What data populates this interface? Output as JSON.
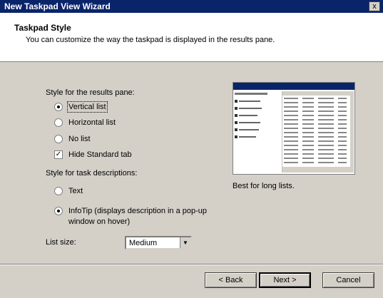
{
  "window": {
    "title": "New Taskpad View Wizard",
    "close_glyph": "x"
  },
  "header": {
    "title": "Taskpad Style",
    "subtitle": "You can customize the way the taskpad is displayed in the results pane."
  },
  "results_pane": {
    "label": "Style for the results pane:",
    "options": [
      {
        "label": "Vertical list",
        "selected": true
      },
      {
        "label": "Horizontal list",
        "selected": false
      },
      {
        "label": "No list",
        "selected": false
      }
    ],
    "hide_standard_tab": {
      "label": "Hide Standard tab",
      "checked": true
    }
  },
  "task_descriptions": {
    "label": "Style for task descriptions:",
    "options": [
      {
        "label": "Text",
        "selected": false
      },
      {
        "label": "InfoTip (displays description in a pop-up",
        "label_line2": "window on hover)",
        "selected": true
      }
    ]
  },
  "list_size": {
    "label": "List size:",
    "value": "Medium"
  },
  "preview": {
    "caption": "Best for long lists."
  },
  "buttons": {
    "back": "< Back",
    "next": "Next >",
    "cancel": "Cancel"
  }
}
